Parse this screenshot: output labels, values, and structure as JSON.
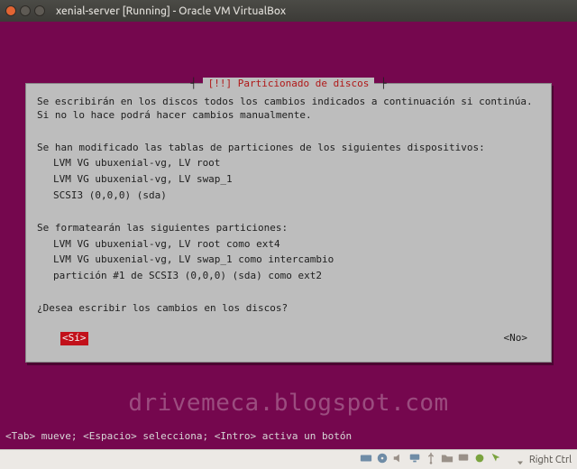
{
  "window": {
    "title": "xenial-server [Running] - Oracle VM VirtualBox"
  },
  "dialog": {
    "title_prefix": "[!!] ",
    "title": "Particionado de discos",
    "p1": "Se escribirán en los discos todos los cambios indicados a continuación si continúa. Si no lo hace podrá hacer cambios manualmente.",
    "p2": "Se han modificado las tablas de particiones de los siguientes dispositivos:",
    "p2_items": {
      "a": "LVM VG ubuxenial-vg, LV root",
      "b": "LVM VG ubuxenial-vg, LV swap_1",
      "c": "SCSI3 (0,0,0) (sda)"
    },
    "p3": "Se formatearán las siguientes particiones:",
    "p3_items": {
      "a": "LVM VG ubuxenial-vg, LV root como ext4",
      "b": "LVM VG ubuxenial-vg, LV swap_1 como intercambio",
      "c": "partición #1 de SCSI3 (0,0,0) (sda) como ext2"
    },
    "p4": "¿Desea escribir los cambios en los discos?",
    "yes": "<Sí>",
    "no": "<No>"
  },
  "helpbar": "<Tab> mueve; <Espacio> selecciona; <Intro> activa un botón",
  "watermark": "drivemeca.blogspot.com",
  "statusbar": {
    "host_key": "Right Ctrl"
  }
}
